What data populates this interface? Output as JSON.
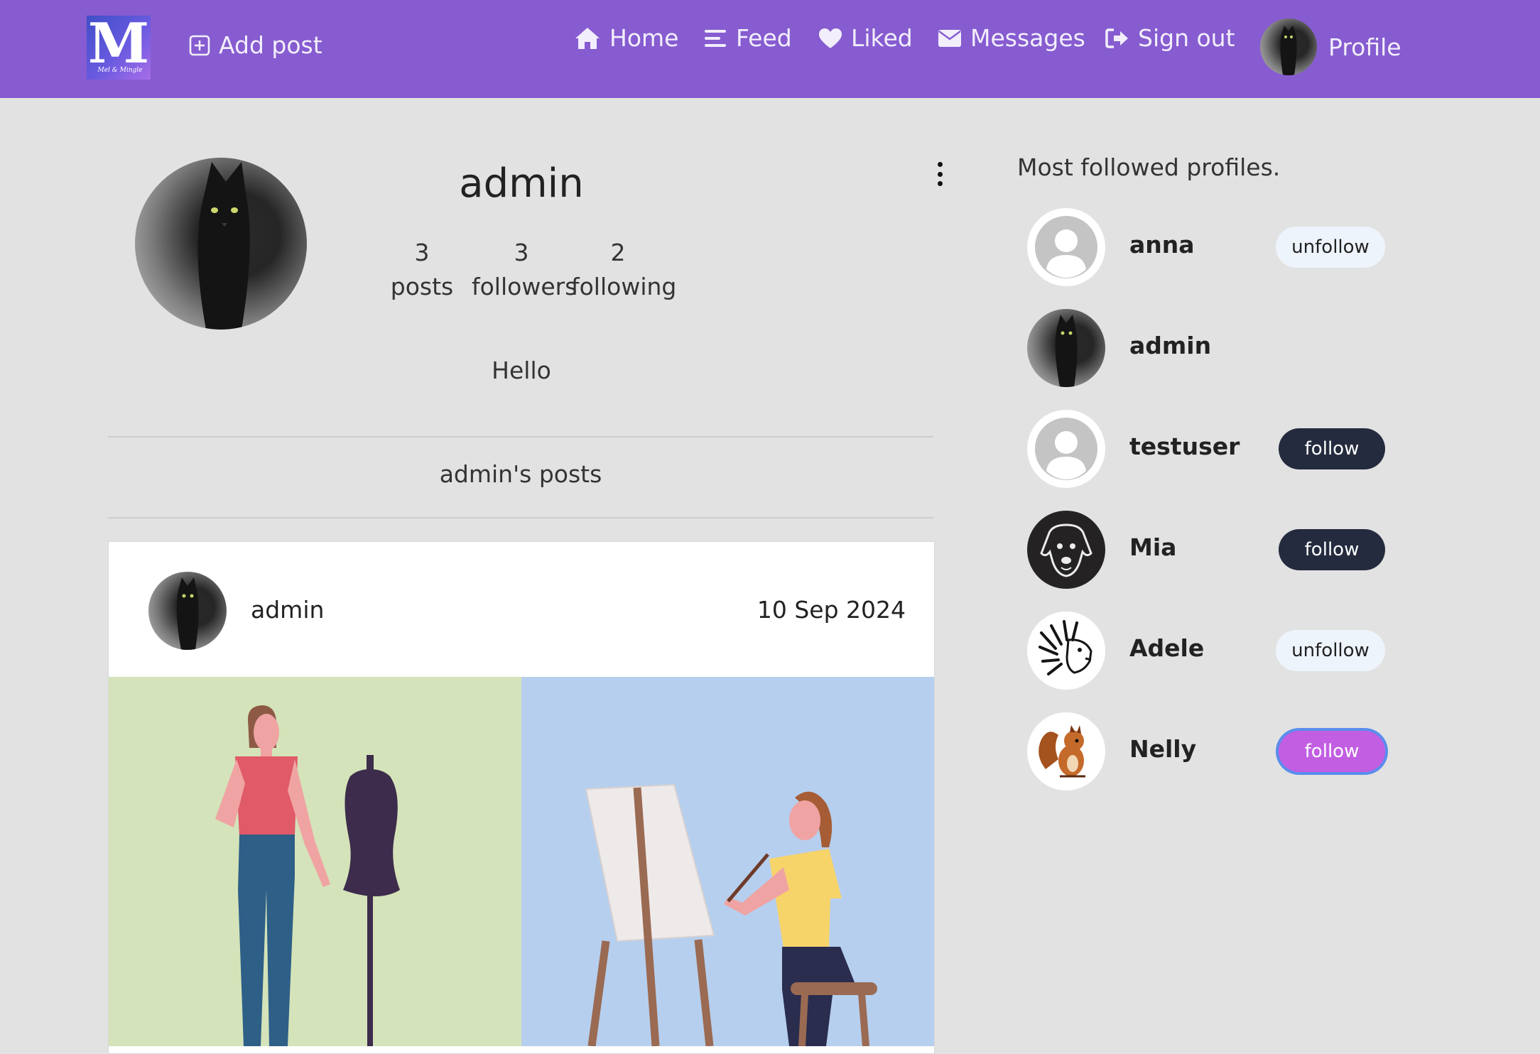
{
  "navbar": {
    "logo_letter": "M",
    "logo_script": "Mel & Mingle",
    "add_post": "Add post",
    "home": "Home",
    "feed": "Feed",
    "liked": "Liked",
    "messages": "Messages",
    "sign_out": "Sign out",
    "profile": "Profile",
    "accent_color": "#865cd0"
  },
  "profile": {
    "username": "admin",
    "stats": [
      {
        "value": "3",
        "label": "posts"
      },
      {
        "value": "3",
        "label": "followers"
      },
      {
        "value": "2",
        "label": "following"
      }
    ],
    "bio": "Hello",
    "posts_heading": "admin's posts"
  },
  "post": {
    "author": "admin",
    "date": "10 Sep 2024"
  },
  "sidebar": {
    "title": "Most followed profiles.",
    "profiles": [
      {
        "name": "anna",
        "action": "unfollow",
        "avatar": "default-avatar-icon"
      },
      {
        "name": "admin",
        "action": "",
        "avatar": "black-cat-photo"
      },
      {
        "name": "testuser",
        "action": "follow",
        "avatar": "default-avatar-icon"
      },
      {
        "name": "Mia",
        "action": "follow",
        "avatar": "dog-drawing"
      },
      {
        "name": "Adele",
        "action": "unfollow",
        "avatar": "lion-drawing"
      },
      {
        "name": "Nelly",
        "action": "follow",
        "avatar": "squirrel-drawing"
      }
    ]
  }
}
